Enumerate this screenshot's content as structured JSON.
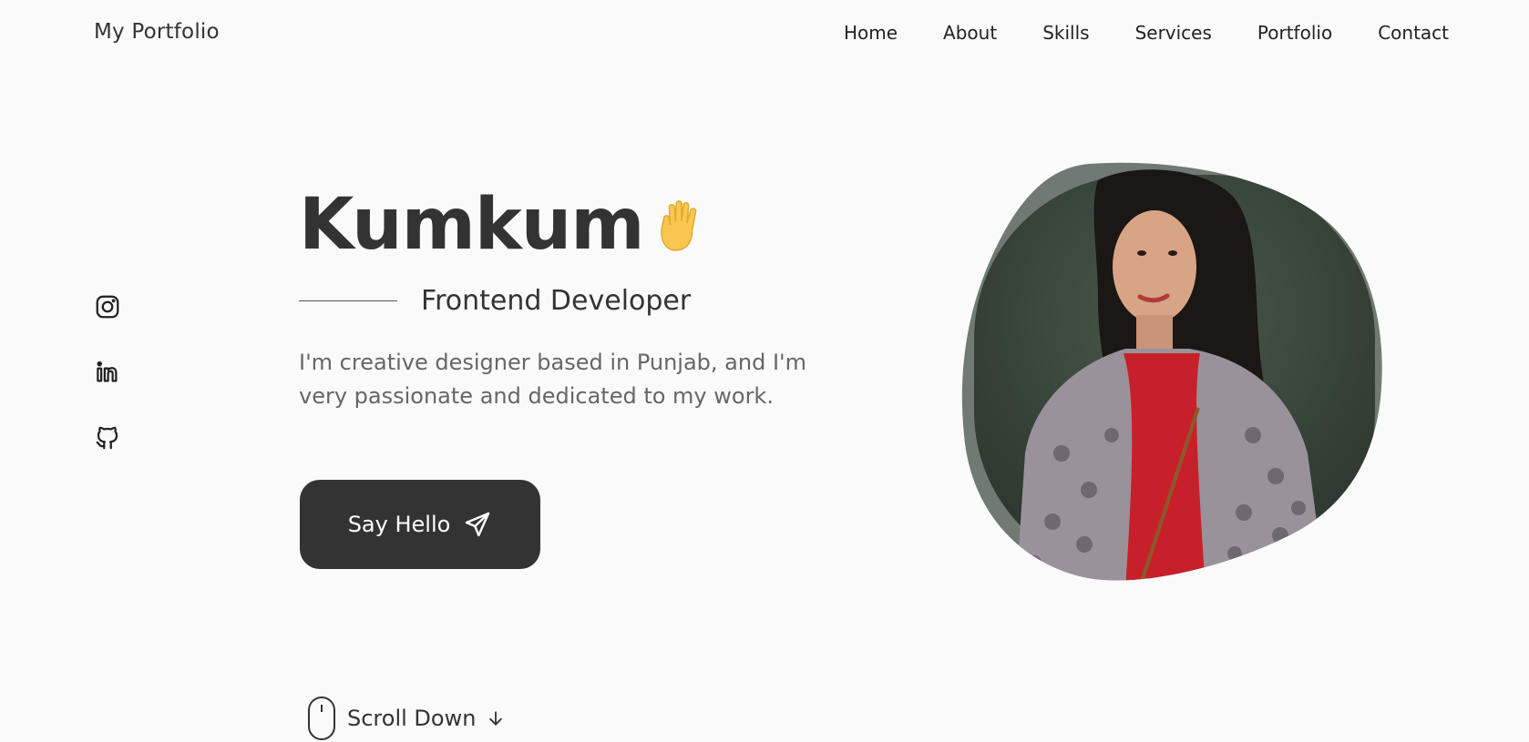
{
  "header": {
    "logo": "My Portfolio",
    "nav": [
      "Home",
      "About",
      "Skills",
      "Services",
      "Portfolio",
      "Contact"
    ]
  },
  "social": [
    "instagram-icon",
    "linkedin-icon",
    "github-icon"
  ],
  "hero": {
    "name": "Kumkum",
    "subtitle": "Frontend Developer",
    "description": "I'm creative designer based in Punjab, and I'm very passionate and dedicated to my work.",
    "cta_label": "Say Hello"
  },
  "scroll": {
    "label": "Scroll Down"
  },
  "colors": {
    "background": "#fafafa",
    "text": "#333333",
    "button": "#333333",
    "muted_text": "#666666",
    "blob_border": "#707a72"
  }
}
